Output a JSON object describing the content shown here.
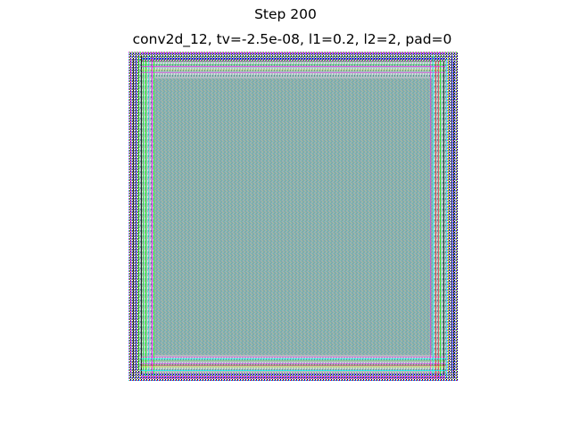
{
  "figure": {
    "suptitle": "Step 200",
    "axes_title": "conv2d_12, tv=-2.5e-08, l1=0.2, l2=2, pad=0"
  },
  "image": {
    "description_role": "feature visualization heatmap",
    "base_color": "#7fb0b0",
    "border_colors": [
      "#ff00ff",
      "#00ff00",
      "#00ffff",
      "#ff0000",
      "#0000ff",
      "#ffff00",
      "#000000"
    ],
    "axis_visible": false
  }
}
